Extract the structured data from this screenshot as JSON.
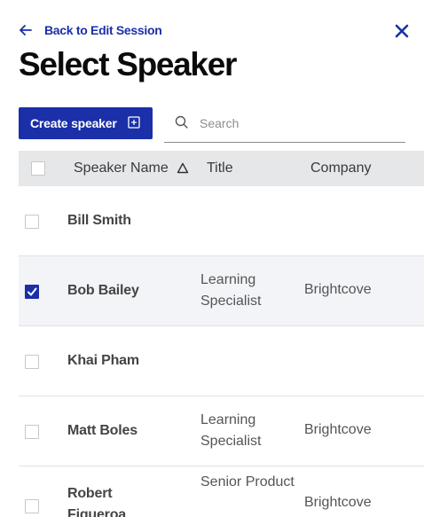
{
  "nav": {
    "back_label": "Back to Edit Session"
  },
  "page": {
    "title": "Select Speaker"
  },
  "toolbar": {
    "create_label": "Create speaker",
    "search_placeholder": "Search",
    "search_value": ""
  },
  "table": {
    "columns": {
      "name": "Speaker Name",
      "title": "Title",
      "company": "Company"
    },
    "sort": "ascending",
    "rows": [
      {
        "name": "Bill Smith",
        "title": "",
        "company": "",
        "checked": false
      },
      {
        "name": "Bob Bailey",
        "title": "Learning Specialist",
        "company": "Brightcove",
        "checked": true
      },
      {
        "name": "Khai Pham",
        "title": "",
        "company": "",
        "checked": false
      },
      {
        "name": "Matt Boles",
        "title": "Learning Specialist",
        "company": "Brightcove",
        "checked": false
      },
      {
        "name": "Robert Figueroa",
        "title": "Senior Product",
        "company": "Brightcove",
        "checked": false
      }
    ]
  },
  "colors": {
    "accent": "#1a2fa8",
    "header_bg": "#e6e7e8",
    "selected_row_bg": "#f2f4f8"
  },
  "icons": {
    "back": "arrow-left-icon",
    "close": "close-icon",
    "create": "plus-square-icon",
    "search": "search-icon",
    "sort": "sort-ascending-icon",
    "check": "checkmark-icon"
  }
}
